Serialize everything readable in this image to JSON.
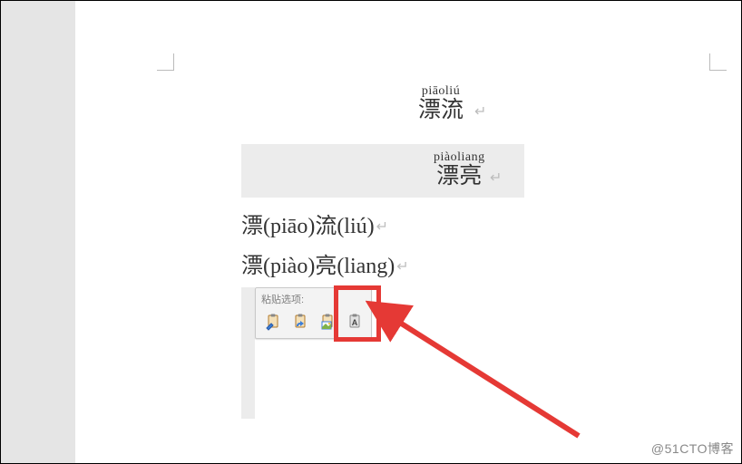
{
  "ruby1": {
    "pinyin": "piāoliú",
    "hanzi": "漂流"
  },
  "ruby2": {
    "pinyin": "piàoliang",
    "hanzi": "漂亮"
  },
  "line1": {
    "h1": "漂",
    "p1": "(piāo)",
    "h2": "流",
    "p2": "(liú)"
  },
  "line2": {
    "h1": "漂",
    "p1": "(piào)",
    "h2": "亮",
    "p2": "(liang)"
  },
  "paste": {
    "title": "粘贴选项:",
    "options": {
      "keep_source": "保留源格式",
      "merge": "合并格式",
      "picture": "图片",
      "text_only": "只保留文本"
    }
  },
  "watermark": "@51CTO博客"
}
